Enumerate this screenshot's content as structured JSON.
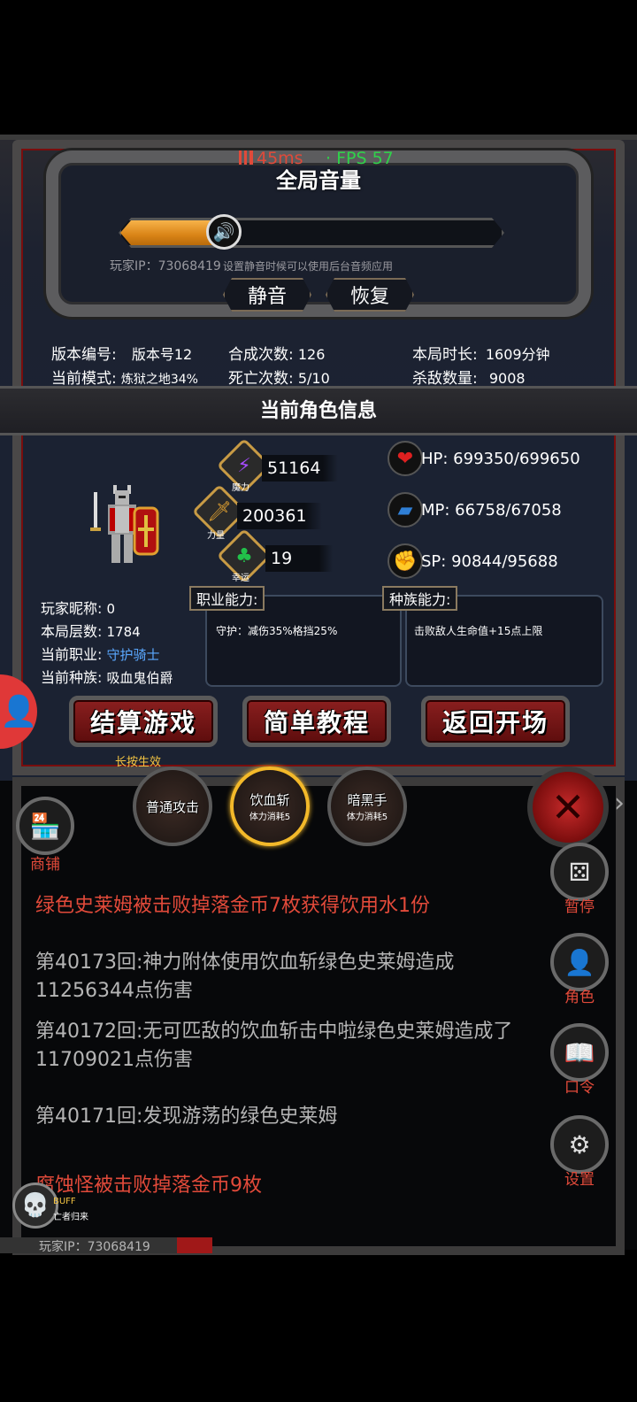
{
  "status": {
    "ping": "45ms",
    "fps": "· FPS 57"
  },
  "volume": {
    "title": "全局音量",
    "level": 0.27,
    "player_ip": "玩家IP：73068419",
    "hint": "设置静音时候可以使用后台音频应用",
    "mute_label": "静音",
    "restore_label": "恢复"
  },
  "stats": {
    "version_label": "版本编号:",
    "version_value": "版本号12",
    "mode_label": "当前模式:",
    "mode_value": "炼狱之地34%",
    "synth_label": "合成次数:",
    "synth_value": "126",
    "death_label": "死亡次数:",
    "death_value": "5/10",
    "time_label": "本局时长:",
    "time_value": "1609分钟",
    "kill_label": "杀敌数量:",
    "kill_value": "9008"
  },
  "character": {
    "title": "当前角色信息",
    "magic_label": "魔力",
    "magic_value": "51164",
    "power_label": "力量",
    "power_value": "200361",
    "luck_label": "幸运",
    "luck_value": "19",
    "hp": "HP:  699350/699650",
    "mp": "MP:  66758/67058",
    "sp": "SP:  90844/95688",
    "nickname_label": "玩家昵称:",
    "nickname_value": "0",
    "floor_label": "本局层数:",
    "floor_value": "1784",
    "job_label": "当前职业:",
    "job_value": "守护骑士",
    "race_label": "当前种族:",
    "race_value": "吸血鬼伯爵",
    "job_ability_title": "职业能力:",
    "job_ability_text": "守护：减伤35%格挡25%",
    "race_ability_title": "种族能力:",
    "race_ability_text": "击败敌人生命值+15点上限",
    "settle_btn": "结算游戏",
    "tutorial_btn": "简单教程",
    "return_btn": "返回开场",
    "long_press": "长按生效"
  },
  "skills": [
    {
      "name": "普通攻击",
      "cost": ""
    },
    {
      "name": "饮血斩",
      "cost": "体力消耗5"
    },
    {
      "name": "暗黑手",
      "cost": "体力消耗5"
    }
  ],
  "side": {
    "shop": "商铺",
    "pause": "暂停",
    "role": "角色",
    "code": "口令",
    "settings": "设置"
  },
  "log": [
    {
      "text": "绿色史莱姆被击败掉落金币7枚获得饮用水1份",
      "type": "red"
    },
    {
      "text": "第40173回:神力附体使用饮血斩绿色史莱姆造成11256344点伤害",
      "type": "gray"
    },
    {
      "text": "第40172回:无可匹敌的饮血斩击中啦绿色史莱姆造成了11709021点伤害",
      "type": "gray"
    },
    {
      "text": "第40171回:发现游荡的绿色史莱姆",
      "type": "gray"
    },
    {
      "text": "腐蚀怪被击败掉落金币9枚",
      "type": "red"
    }
  ],
  "buff": {
    "label": "BUFF",
    "sub": "亡者归来"
  },
  "footer_ip": "玩家IP：73068419",
  "colors": {
    "accent_red": "#e24a3a",
    "gold": "#f5c542",
    "fps_green": "#2fd24a",
    "job_blue": "#5aa8ff"
  }
}
